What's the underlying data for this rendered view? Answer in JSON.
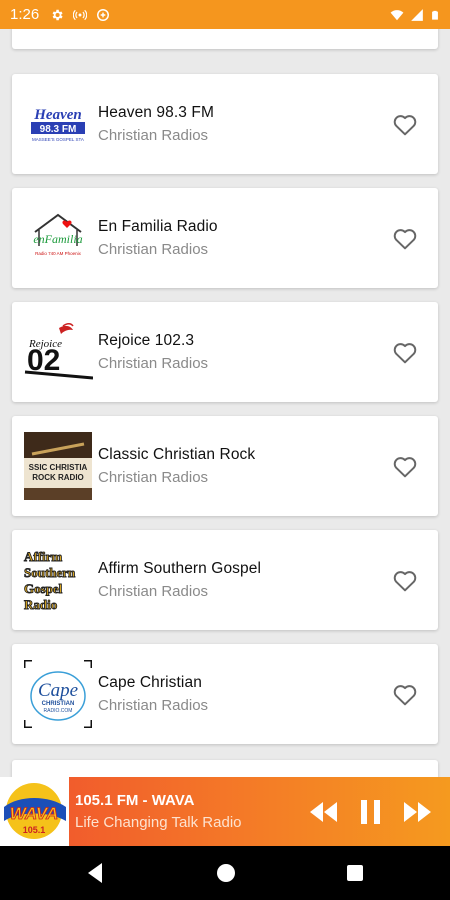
{
  "status_bar": {
    "time": "1:26"
  },
  "stations": [
    {
      "name": "Heaven 98.3 FM",
      "category": "Christian Radios",
      "logo": "heaven-logo",
      "logo_text": [
        "Heaven",
        "98.3 FM",
        "MASSEE'S GOSPEL STA"
      ]
    },
    {
      "name": "En Familia Radio",
      "category": "Christian Radios",
      "logo": "en-familia-logo",
      "logo_text": [
        "enFamilia",
        "Radio 740 AM Phoenix"
      ]
    },
    {
      "name": "Rejoice 102.3",
      "category": "Christian Radios",
      "logo": "rejoice-logo",
      "logo_text": [
        "Rejoice",
        "02"
      ]
    },
    {
      "name": "Classic Christian Rock",
      "category": "Christian Radios",
      "logo": "classic-christian-rock-logo",
      "logo_text": [
        "SSIC CHRISTIA",
        "ROCK RADIO"
      ]
    },
    {
      "name": "Affirm Southern Gospel",
      "category": "Christian Radios",
      "logo": "affirm-logo",
      "logo_text": [
        "Affirm",
        "Southern",
        "Gospel",
        "Radio"
      ]
    },
    {
      "name": "Cape Christian",
      "category": "Christian Radios",
      "logo": "cape-christian-logo",
      "logo_text": [
        "Cape",
        "CHRISTIAN",
        "RADIO.COM"
      ]
    }
  ],
  "player": {
    "title": "105.1 FM - WAVA",
    "subtitle": "Life Changing Talk Radio",
    "art_text": [
      "WAVA",
      "105.1"
    ]
  },
  "colors": {
    "accent": "#f5961e",
    "player_start": "#f0512e",
    "player_end": "#f59a1f"
  }
}
